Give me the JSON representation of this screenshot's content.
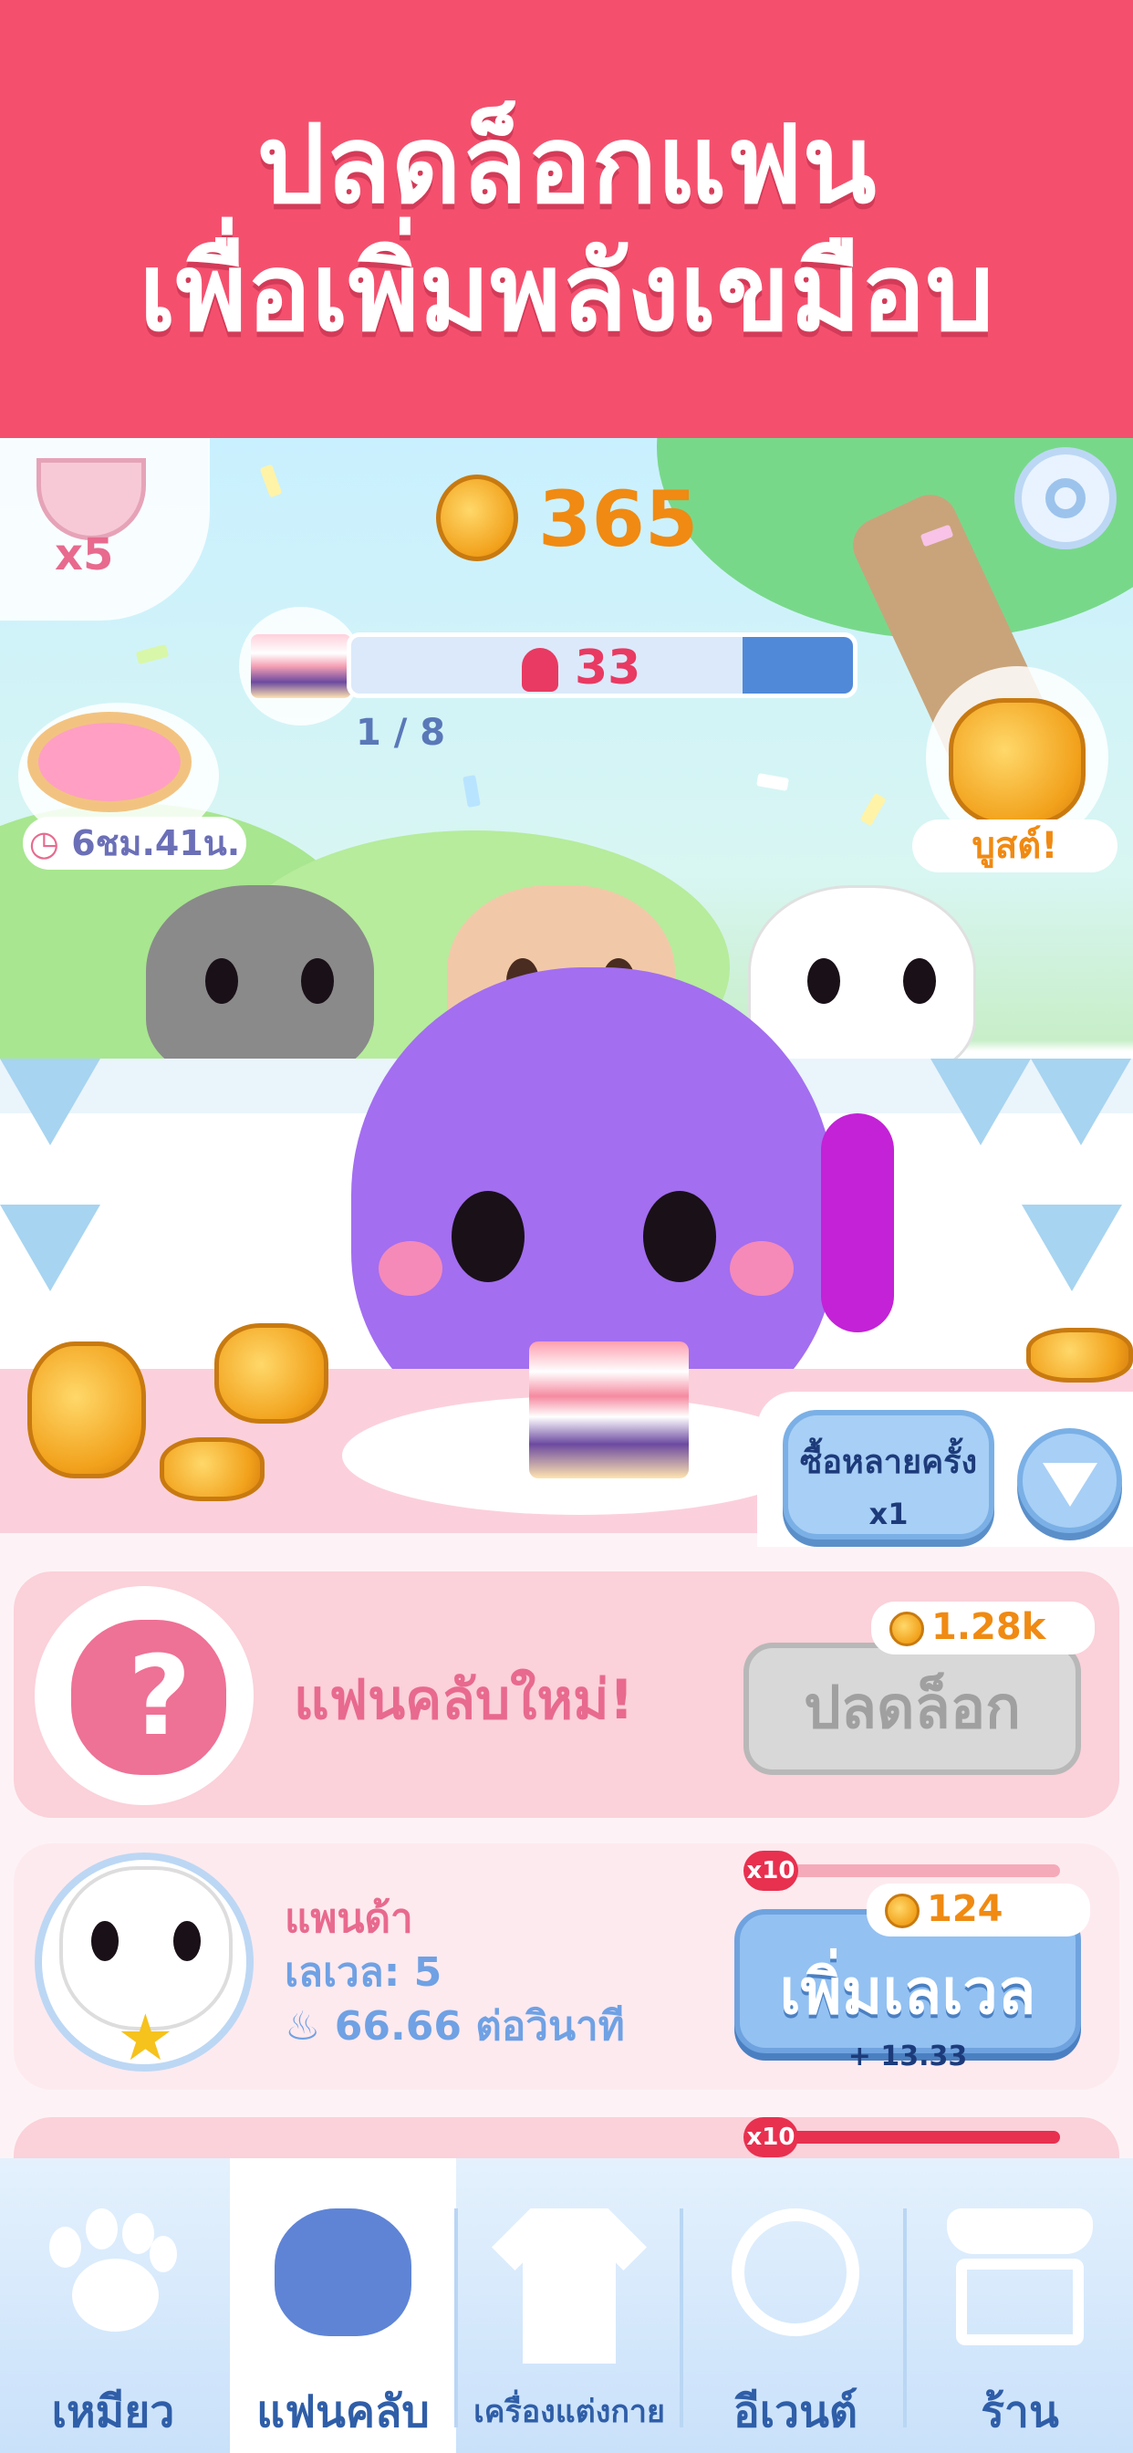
{
  "banner": {
    "line1": "ปลดล็อกแฟน",
    "line2": "เพื่อเพิ่มพลังเขมือบ"
  },
  "hud": {
    "trophy_count": "x5",
    "coins": "365",
    "cake_progress_value": "33",
    "cake_progress_fraction": 0.22,
    "level_step": "1 / 8",
    "donut_timer": "6ชม.41น.",
    "boost_label": "บูสต์!"
  },
  "buy_multi": {
    "label": "ซื้อหลายครั้ง",
    "value": "x1"
  },
  "new_fan": {
    "label": "แฟนคลับใหม่!",
    "price": "1.28k",
    "button": "ปลดล็อก"
  },
  "panda": {
    "name": "แพนด้า",
    "level": "เลเวล: 5",
    "rate": "66.66 ต่อวินาที",
    "multiplier": "x10",
    "upgrade_price": "124",
    "upgrade_label": "เพิ่มเลเวล",
    "upgrade_gain": "+ 13.33"
  },
  "third": {
    "multiplier": "x10"
  },
  "nav": {
    "items": [
      {
        "label": "เหมียว",
        "icon": "paw-icon"
      },
      {
        "label": "แฟนคลับ",
        "icon": "cat-head-icon"
      },
      {
        "label": "เครื่องแต่งกาย",
        "icon": "shirt-icon"
      },
      {
        "label": "อีเวนต์",
        "icon": "clock-icon"
      },
      {
        "label": "ร้าน",
        "icon": "shop-icon"
      }
    ],
    "active_index": 1
  },
  "colors": {
    "banner": "#f4506e",
    "accent_blue": "#93c1f2",
    "coin": "#f08a12"
  }
}
